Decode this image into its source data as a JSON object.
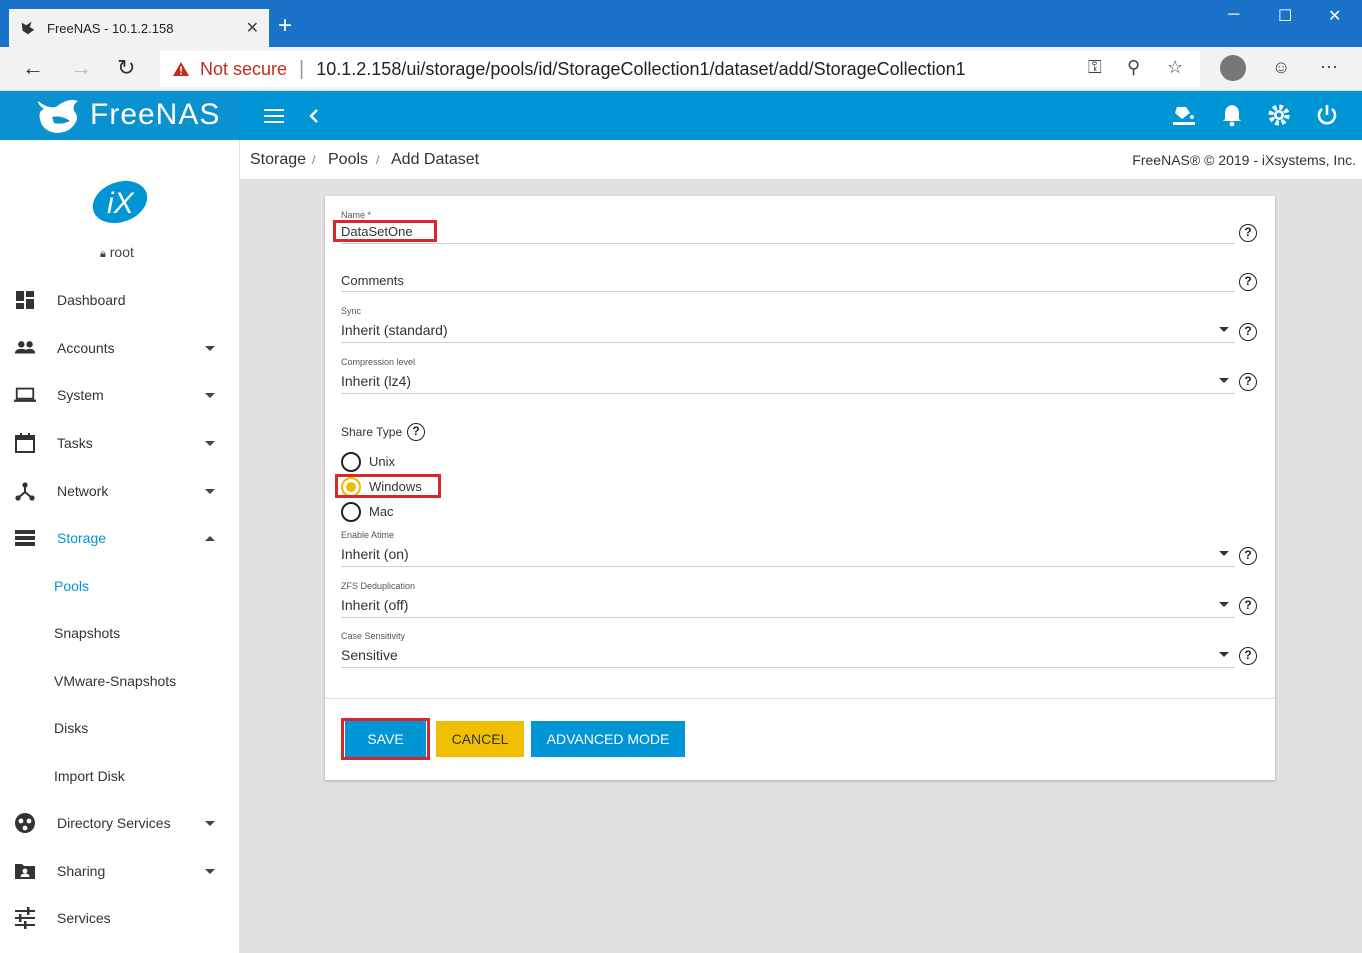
{
  "browser": {
    "tab_title": "FreeNAS - 10.1.2.158",
    "tab_close": "✕",
    "new_tab": "+",
    "security_label": "Not secure",
    "url": "10.1.2.158/ui/storage/pools/id/StorageCollection1/dataset/add/StorageCollection1",
    "window_controls": [
      "─",
      "☐",
      "✕"
    ]
  },
  "app": {
    "logo_text": "FreeNAS",
    "logo_tm": "®"
  },
  "sidebar": {
    "username": "root",
    "items": [
      {
        "label": "Dashboard",
        "icon": "dashboard-icon"
      },
      {
        "label": "Accounts",
        "icon": "accounts-icon"
      },
      {
        "label": "System",
        "icon": "system-icon"
      },
      {
        "label": "Tasks",
        "icon": "tasks-icon"
      },
      {
        "label": "Network",
        "icon": "network-icon"
      },
      {
        "label": "Storage",
        "icon": "storage-icon"
      },
      {
        "label": "Directory Services",
        "icon": "directory-services-icon"
      },
      {
        "label": "Sharing",
        "icon": "sharing-icon"
      },
      {
        "label": "Services",
        "icon": "services-icon"
      }
    ],
    "storage_sub": [
      "Pools",
      "Snapshots",
      "VMware-Snapshots",
      "Disks",
      "Import Disk"
    ]
  },
  "breadcrumb": {
    "items": [
      "Storage",
      "Pools",
      "Add Dataset"
    ],
    "sep": "/",
    "copyright": "FreeNAS® © 2019 - iXsystems, Inc."
  },
  "form": {
    "name_label": "Name *",
    "name_value": "DataSetOne",
    "comments_label": "Comments",
    "sync_label": "Sync",
    "sync_value": "Inherit (standard)",
    "compression_label": "Compression level",
    "compression_value": "Inherit (lz4)",
    "share_type_label": "Share Type",
    "share_types": [
      "Unix",
      "Windows",
      "Mac"
    ],
    "selected_share_type": "Windows",
    "atime_label": "Enable Atime",
    "atime_value": "Inherit (on)",
    "dedup_label": "ZFS Deduplication",
    "dedup_value": "Inherit (off)",
    "case_label": "Case Sensitivity",
    "case_value": "Sensitive",
    "help_glyph": "?",
    "save": "SAVE",
    "cancel": "CANCEL",
    "advanced": "ADVANCED MODE"
  },
  "colors": {
    "brand_blue": "#0095d5",
    "save_button": "#0095d5",
    "cancel_button": "#f0c000",
    "highlight_red": "#d9272e"
  }
}
